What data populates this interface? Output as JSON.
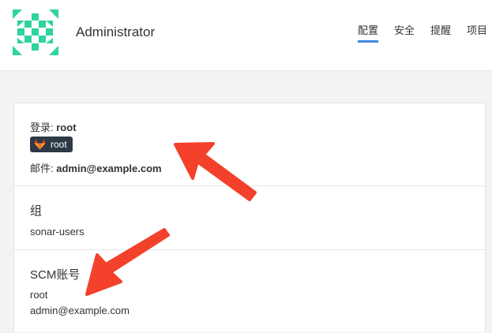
{
  "header": {
    "admin_name": "Administrator",
    "nav": [
      {
        "label": "配置",
        "active": true
      },
      {
        "label": "安全",
        "active": false
      },
      {
        "label": "提醒",
        "active": false
      },
      {
        "label": "项目",
        "active": false
      }
    ]
  },
  "profile": {
    "login_label": "登录:",
    "login_value": "root",
    "provider_badge": {
      "icon": "gitlab-icon",
      "label": "root"
    },
    "email_label": "邮件:",
    "email_value": "admin@example.com"
  },
  "groups": {
    "heading": "组",
    "items": [
      "sonar-users"
    ]
  },
  "scm": {
    "heading": "SCM账号",
    "items": [
      "root",
      "admin@example.com"
    ]
  },
  "colors": {
    "avatar_green": "#2ed3a0",
    "nav_active": "#3a8ad8",
    "arrow_red": "#f3412b",
    "badge_bg": "#2e3947"
  }
}
